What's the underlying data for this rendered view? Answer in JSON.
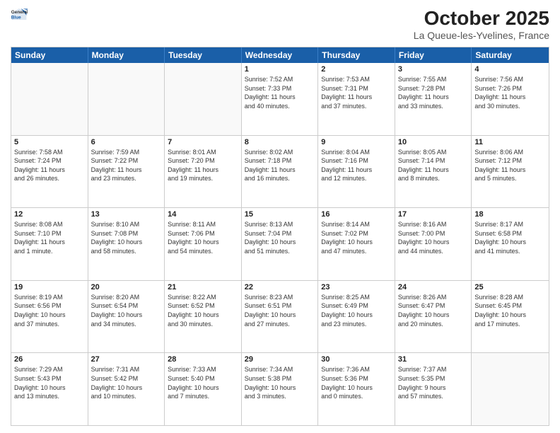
{
  "header": {
    "logo": {
      "general": "General",
      "blue": "Blue"
    },
    "title": "October 2025",
    "location": "La Queue-les-Yvelines, France"
  },
  "weekdays": [
    "Sunday",
    "Monday",
    "Tuesday",
    "Wednesday",
    "Thursday",
    "Friday",
    "Saturday"
  ],
  "rows": [
    [
      {
        "day": "",
        "info": ""
      },
      {
        "day": "",
        "info": ""
      },
      {
        "day": "",
        "info": ""
      },
      {
        "day": "1",
        "info": "Sunrise: 7:52 AM\nSunset: 7:33 PM\nDaylight: 11 hours\nand 40 minutes."
      },
      {
        "day": "2",
        "info": "Sunrise: 7:53 AM\nSunset: 7:31 PM\nDaylight: 11 hours\nand 37 minutes."
      },
      {
        "day": "3",
        "info": "Sunrise: 7:55 AM\nSunset: 7:28 PM\nDaylight: 11 hours\nand 33 minutes."
      },
      {
        "day": "4",
        "info": "Sunrise: 7:56 AM\nSunset: 7:26 PM\nDaylight: 11 hours\nand 30 minutes."
      }
    ],
    [
      {
        "day": "5",
        "info": "Sunrise: 7:58 AM\nSunset: 7:24 PM\nDaylight: 11 hours\nand 26 minutes."
      },
      {
        "day": "6",
        "info": "Sunrise: 7:59 AM\nSunset: 7:22 PM\nDaylight: 11 hours\nand 23 minutes."
      },
      {
        "day": "7",
        "info": "Sunrise: 8:01 AM\nSunset: 7:20 PM\nDaylight: 11 hours\nand 19 minutes."
      },
      {
        "day": "8",
        "info": "Sunrise: 8:02 AM\nSunset: 7:18 PM\nDaylight: 11 hours\nand 16 minutes."
      },
      {
        "day": "9",
        "info": "Sunrise: 8:04 AM\nSunset: 7:16 PM\nDaylight: 11 hours\nand 12 minutes."
      },
      {
        "day": "10",
        "info": "Sunrise: 8:05 AM\nSunset: 7:14 PM\nDaylight: 11 hours\nand 8 minutes."
      },
      {
        "day": "11",
        "info": "Sunrise: 8:06 AM\nSunset: 7:12 PM\nDaylight: 11 hours\nand 5 minutes."
      }
    ],
    [
      {
        "day": "12",
        "info": "Sunrise: 8:08 AM\nSunset: 7:10 PM\nDaylight: 11 hours\nand 1 minute."
      },
      {
        "day": "13",
        "info": "Sunrise: 8:10 AM\nSunset: 7:08 PM\nDaylight: 10 hours\nand 58 minutes."
      },
      {
        "day": "14",
        "info": "Sunrise: 8:11 AM\nSunset: 7:06 PM\nDaylight: 10 hours\nand 54 minutes."
      },
      {
        "day": "15",
        "info": "Sunrise: 8:13 AM\nSunset: 7:04 PM\nDaylight: 10 hours\nand 51 minutes."
      },
      {
        "day": "16",
        "info": "Sunrise: 8:14 AM\nSunset: 7:02 PM\nDaylight: 10 hours\nand 47 minutes."
      },
      {
        "day": "17",
        "info": "Sunrise: 8:16 AM\nSunset: 7:00 PM\nDaylight: 10 hours\nand 44 minutes."
      },
      {
        "day": "18",
        "info": "Sunrise: 8:17 AM\nSunset: 6:58 PM\nDaylight: 10 hours\nand 41 minutes."
      }
    ],
    [
      {
        "day": "19",
        "info": "Sunrise: 8:19 AM\nSunset: 6:56 PM\nDaylight: 10 hours\nand 37 minutes."
      },
      {
        "day": "20",
        "info": "Sunrise: 8:20 AM\nSunset: 6:54 PM\nDaylight: 10 hours\nand 34 minutes."
      },
      {
        "day": "21",
        "info": "Sunrise: 8:22 AM\nSunset: 6:52 PM\nDaylight: 10 hours\nand 30 minutes."
      },
      {
        "day": "22",
        "info": "Sunrise: 8:23 AM\nSunset: 6:51 PM\nDaylight: 10 hours\nand 27 minutes."
      },
      {
        "day": "23",
        "info": "Sunrise: 8:25 AM\nSunset: 6:49 PM\nDaylight: 10 hours\nand 23 minutes."
      },
      {
        "day": "24",
        "info": "Sunrise: 8:26 AM\nSunset: 6:47 PM\nDaylight: 10 hours\nand 20 minutes."
      },
      {
        "day": "25",
        "info": "Sunrise: 8:28 AM\nSunset: 6:45 PM\nDaylight: 10 hours\nand 17 minutes."
      }
    ],
    [
      {
        "day": "26",
        "info": "Sunrise: 7:29 AM\nSunset: 5:43 PM\nDaylight: 10 hours\nand 13 minutes."
      },
      {
        "day": "27",
        "info": "Sunrise: 7:31 AM\nSunset: 5:42 PM\nDaylight: 10 hours\nand 10 minutes."
      },
      {
        "day": "28",
        "info": "Sunrise: 7:33 AM\nSunset: 5:40 PM\nDaylight: 10 hours\nand 7 minutes."
      },
      {
        "day": "29",
        "info": "Sunrise: 7:34 AM\nSunset: 5:38 PM\nDaylight: 10 hours\nand 3 minutes."
      },
      {
        "day": "30",
        "info": "Sunrise: 7:36 AM\nSunset: 5:36 PM\nDaylight: 10 hours\nand 0 minutes."
      },
      {
        "day": "31",
        "info": "Sunrise: 7:37 AM\nSunset: 5:35 PM\nDaylight: 9 hours\nand 57 minutes."
      },
      {
        "day": "",
        "info": ""
      }
    ]
  ]
}
